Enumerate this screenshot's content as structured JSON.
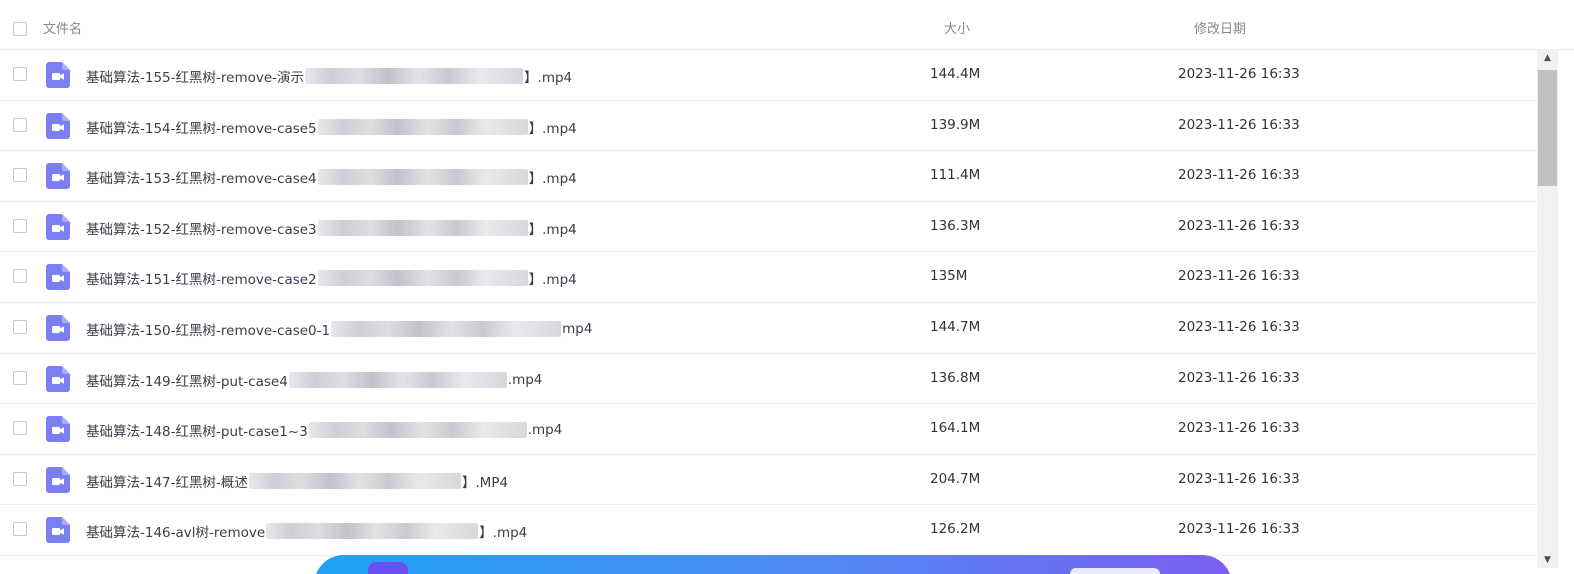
{
  "header": {
    "name_label": "文件名",
    "size_label": "大小",
    "date_label": "修改日期"
  },
  "icons": {
    "file": "video-file-icon",
    "file_color": "#7b7ff3"
  },
  "files": [
    {
      "prefix": "基础算法-155-红黑树-remove-演示",
      "suffix": "】.mp4",
      "blur_width": 218,
      "size": "144.4M",
      "date": "2023-11-26 16:33"
    },
    {
      "prefix": "基础算法-154-红黑树-remove-case5",
      "suffix": "】.mp4",
      "blur_width": 210,
      "size": "139.9M",
      "date": "2023-11-26 16:33"
    },
    {
      "prefix": "基础算法-153-红黑树-remove-case4",
      "suffix": "】.mp4",
      "blur_width": 210,
      "size": "111.4M",
      "date": "2023-11-26 16:33"
    },
    {
      "prefix": "基础算法-152-红黑树-remove-case3",
      "suffix": "】.mp4",
      "blur_width": 210,
      "size": "136.3M",
      "date": "2023-11-26 16:33"
    },
    {
      "prefix": "基础算法-151-红黑树-remove-case2",
      "suffix": "】.mp4",
      "blur_width": 210,
      "size": "135M",
      "date": "2023-11-26 16:33"
    },
    {
      "prefix": "基础算法-150-红黑树-remove-case0-1",
      "suffix": "mp4",
      "blur_width": 230,
      "size": "144.7M",
      "date": "2023-11-26 16:33"
    },
    {
      "prefix": "基础算法-149-红黑树-put-case4",
      "suffix": ".mp4",
      "blur_width": 218,
      "size": "136.8M",
      "date": "2023-11-26 16:33"
    },
    {
      "prefix": "基础算法-148-红黑树-put-case1~3",
      "suffix": ".mp4",
      "blur_width": 218,
      "size": "164.1M",
      "date": "2023-11-26 16:33"
    },
    {
      "prefix": "基础算法-147-红黑树-概述",
      "suffix": "】.MP4",
      "blur_width": 212,
      "size": "204.7M",
      "date": "2023-11-26 16:33"
    },
    {
      "prefix": "基础算法-146-avl树-remove",
      "suffix": "】.mp4",
      "blur_width": 212,
      "size": "126.2M",
      "date": "2023-11-26 16:33"
    }
  ]
}
